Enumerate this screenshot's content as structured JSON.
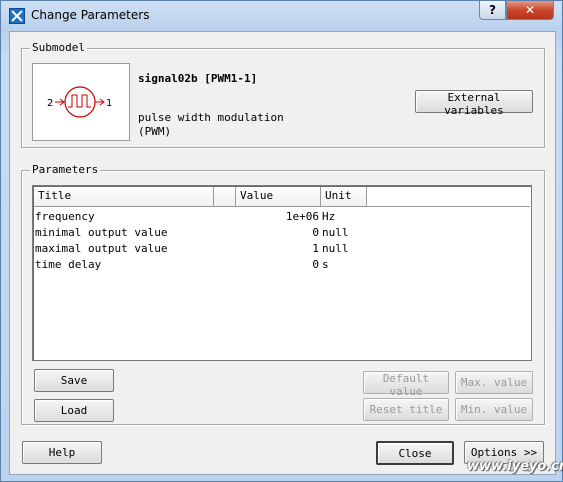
{
  "window": {
    "title": "Change Parameters",
    "help_label": "?",
    "close_label": "✕"
  },
  "submodel": {
    "group_label": "Submodel",
    "name": "signal02b [PWM1-1]",
    "description_line1": "pulse width modulation",
    "description_line2": "(PWM)",
    "port_in": "2",
    "port_out": "1",
    "external_variables_label": "External variables"
  },
  "parameters": {
    "group_label": "Parameters",
    "columns": [
      "Title",
      "",
      "Value",
      "Unit"
    ],
    "rows": [
      {
        "title": "frequency",
        "value": "1e+06",
        "unit": "Hz"
      },
      {
        "title": "minimal output value",
        "value": "0",
        "unit": "null"
      },
      {
        "title": "maximal output value",
        "value": "1",
        "unit": "null"
      },
      {
        "title": "time delay",
        "value": "0",
        "unit": "s"
      }
    ],
    "buttons": {
      "save": "Save",
      "load": "Load",
      "default_value": "Default value",
      "max_value": "Max. value",
      "reset_title": "Reset title",
      "min_value": "Min. value"
    }
  },
  "footer": {
    "help": "Help",
    "close": "Close",
    "options": "Options >>"
  },
  "watermark": "www.iyeyo.cn"
}
